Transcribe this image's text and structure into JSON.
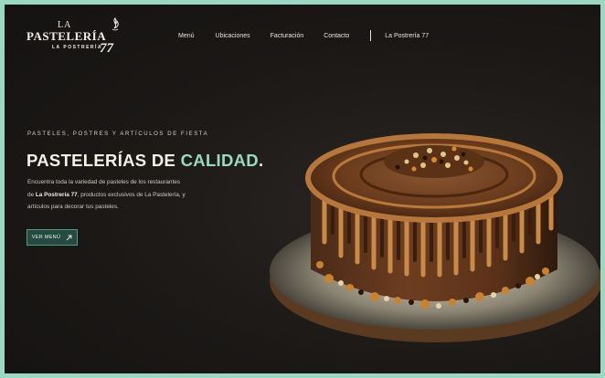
{
  "logo": {
    "la": "LA",
    "brand": "PASTELERÍA",
    "sub": "LA POSTRERÍA",
    "num": "77"
  },
  "nav": {
    "items": [
      "Menú",
      "Ubicaciones",
      "Facturación",
      "Contacto"
    ],
    "extra": "La Postrería 77"
  },
  "hero": {
    "kicker": "PASTELES, POSTRES Y ARTÍCULOS DE FIESTA",
    "title_main": "PASTELERÍAS DE ",
    "title_accent": "CALIDAD",
    "title_end": ".",
    "desc_line1": "Encuentra toda la variedad de pasteles de los restaurantes",
    "desc_line2_pre": "de ",
    "desc_line2_bold": "La Postrería 77",
    "desc_line2_post": ", productos exclusivos de La Pastelería, y",
    "desc_line3": "artículos para decorar tus pasteles.",
    "cta_label": "VER MENÚ",
    "cta_icon": "arrow-up-right-icon"
  },
  "colors": {
    "accent": "#9bd8c4",
    "background": "#1b1816",
    "button_bg": "#244a41"
  }
}
